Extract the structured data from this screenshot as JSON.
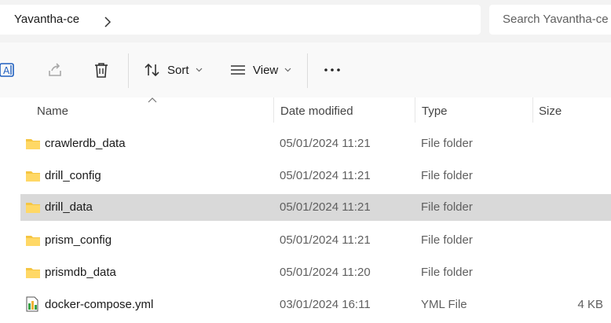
{
  "address": {
    "breadcrumb": "Yavantha-ce",
    "search_placeholder": "Search Yavantha-ce"
  },
  "toolbar": {
    "sort_label": "Sort",
    "view_label": "View"
  },
  "columns": {
    "name": "Name",
    "date": "Date modified",
    "type": "Type",
    "size": "Size"
  },
  "colors": {
    "folder": "#f5c542",
    "selected_row": "#d9d9d9"
  },
  "files": [
    {
      "name": "crawlerdb_data",
      "date": "05/01/2024 11:21",
      "type": "File folder",
      "size": "",
      "icon": "folder-icon",
      "selected": false
    },
    {
      "name": "drill_config",
      "date": "05/01/2024 11:21",
      "type": "File folder",
      "size": "",
      "icon": "folder-icon",
      "selected": false
    },
    {
      "name": "drill_data",
      "date": "05/01/2024 11:21",
      "type": "File folder",
      "size": "",
      "icon": "folder-icon",
      "selected": true
    },
    {
      "name": "prism_config",
      "date": "05/01/2024 11:21",
      "type": "File folder",
      "size": "",
      "icon": "folder-icon",
      "selected": false
    },
    {
      "name": "prismdb_data",
      "date": "05/01/2024 11:20",
      "type": "File folder",
      "size": "",
      "icon": "folder-icon",
      "selected": false
    },
    {
      "name": "docker-compose.yml",
      "date": "03/01/2024 16:11",
      "type": "YML File",
      "size": "4 KB",
      "icon": "yml-file-icon",
      "selected": false
    }
  ]
}
